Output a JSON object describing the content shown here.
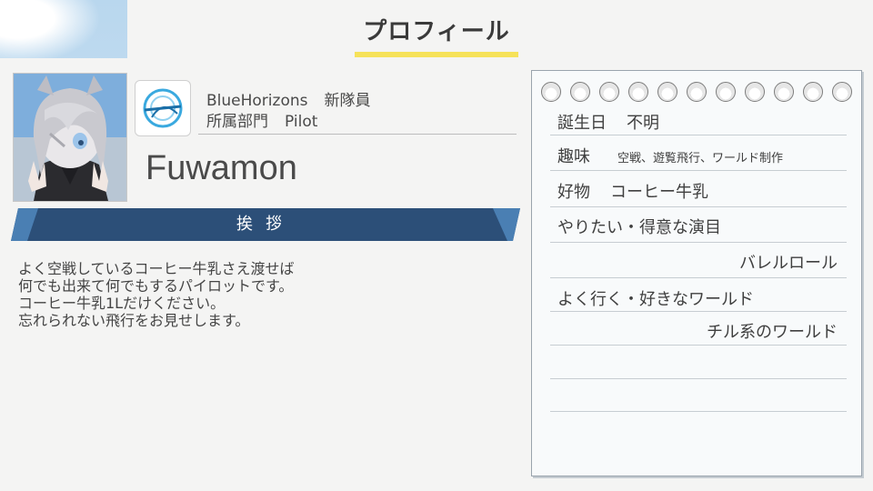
{
  "header": {
    "title": "プロフィール"
  },
  "player": {
    "team": "BlueHorizons",
    "team_rank": "新隊員",
    "department_label": "所属部門",
    "department": "Pilot",
    "name": "Fuwamon"
  },
  "greeting": {
    "label": "挨拶",
    "lines": [
      "よく空戦しているコーヒー牛乳さえ渡せば",
      "何でも出来て何でもするパイロットです。",
      "コーヒー牛乳1Lだけください。",
      "忘れられない飛行をお見せします。"
    ]
  },
  "notebook": {
    "birthday_label": "誕生日",
    "birthday_value": "不明",
    "hobby_label": "趣味",
    "hobby_value": "空戦、遊覧飛行、ワールド制作",
    "favorite_label": "好物",
    "favorite_value": "コーヒー牛乳",
    "skill_label": "やりたい・得意な演目",
    "skill_value": "バレルロール",
    "world_label": "よく行く・好きなワールド",
    "world_value": "チル系のワールド"
  },
  "colors": {
    "accent_yellow": "#f6e25a",
    "greeting_bar": "#2c4f78",
    "greeting_bar_light": "#4a7fb3"
  }
}
